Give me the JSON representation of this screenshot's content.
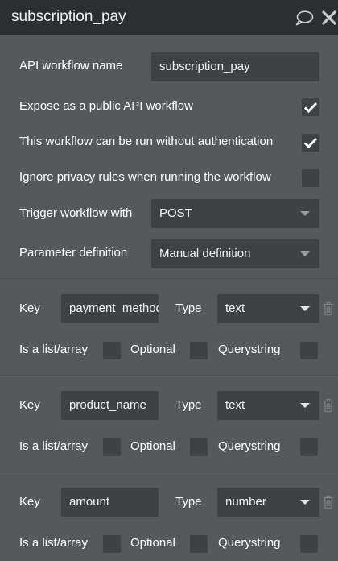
{
  "header": {
    "title": "subscription_pay"
  },
  "settings": {
    "workflow_name_label": "API workflow name",
    "workflow_name_value": "subscription_pay",
    "expose_label": "Expose as a public API workflow",
    "expose_checked": true,
    "no_auth_label": "This workflow can be run without authentication",
    "no_auth_checked": true,
    "ignore_privacy_label": "Ignore privacy rules when running the workflow",
    "ignore_privacy_checked": false,
    "trigger_label": "Trigger workflow with",
    "trigger_value": "POST",
    "param_def_label": "Parameter definition",
    "param_def_value": "Manual definition"
  },
  "parameters": [
    {
      "key_label": "Key",
      "key_value": "payment_method",
      "type_label": "Type",
      "type_value": "text",
      "list_label": "Is a list/array",
      "optional_label": "Optional",
      "querystring_label": "Querystring"
    },
    {
      "key_label": "Key",
      "key_value": "product_name",
      "type_label": "Type",
      "type_value": "text",
      "list_label": "Is a list/array",
      "optional_label": "Optional",
      "querystring_label": "Querystring"
    },
    {
      "key_label": "Key",
      "key_value": "amount",
      "type_label": "Type",
      "type_value": "number",
      "list_label": "Is a list/array",
      "optional_label": "Optional",
      "querystring_label": "Querystring"
    }
  ],
  "icons": {
    "comment": "comment-icon",
    "close": "close-icon",
    "check": "checkmark-icon",
    "trash": "trash-icon",
    "dropdown": "chevron-down-icon"
  }
}
